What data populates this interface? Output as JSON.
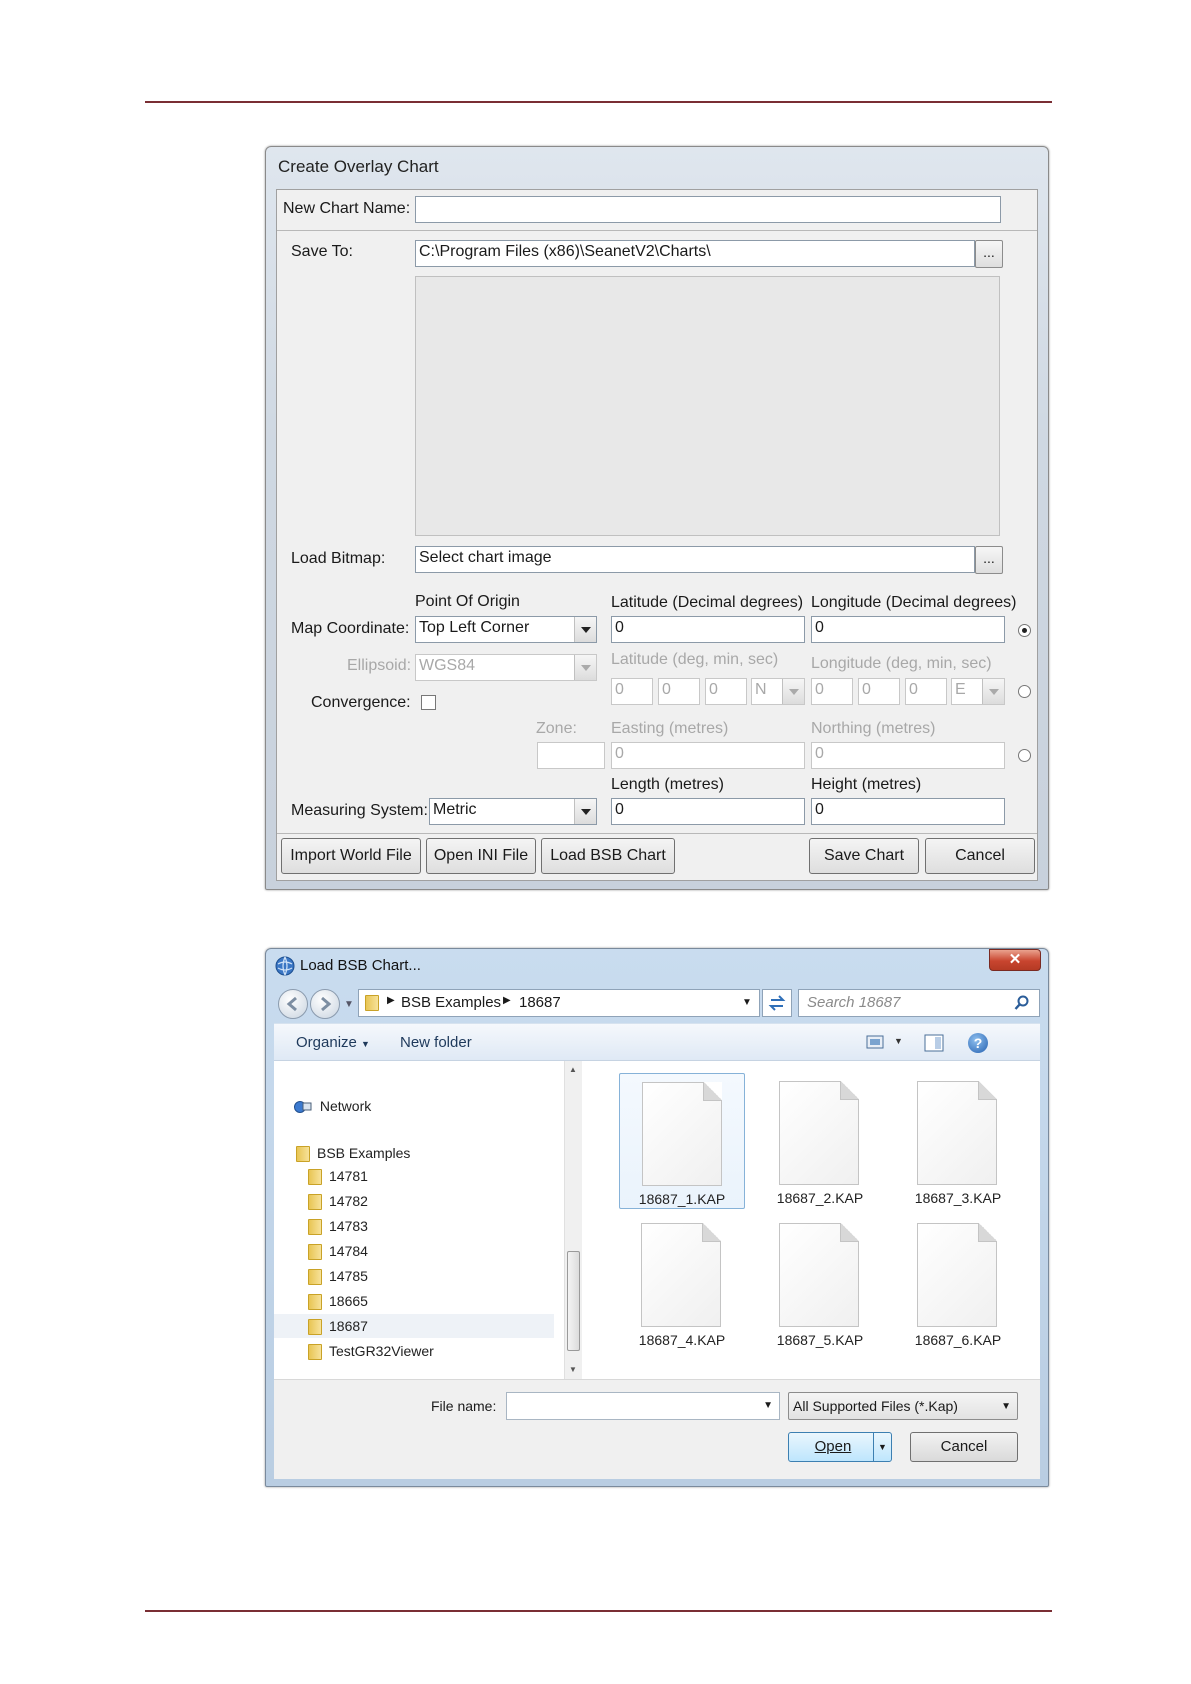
{
  "create_dialog": {
    "title": "Create Overlay Chart",
    "new_chart_name_label": "New Chart Name:",
    "new_chart_name_value": "",
    "save_to_label": "Save To:",
    "save_to_value": "C:\\Program Files (x86)\\SeanetV2\\Charts\\",
    "browse_label": "...",
    "load_bitmap_label": "Load Bitmap:",
    "load_bitmap_value": "Select chart image",
    "point_of_origin_label": "Point Of Origin",
    "map_coordinate_label": "Map Coordinate:",
    "map_coordinate_value": "Top Left Corner",
    "lat_decimal_label": "Latitude (Decimal degrees)",
    "lon_decimal_label": "Longitude (Decimal degrees)",
    "lat_decimal_value": "0",
    "lon_decimal_value": "0",
    "ellipsoid_label": "Ellipsoid:",
    "ellipsoid_value": "WGS84",
    "lat_dms_label": "Latitude (deg, min, sec)",
    "lon_dms_label": "Longitude (deg, min, sec)",
    "lat_dms": [
      "0",
      "0",
      "0"
    ],
    "lat_hemi": "N",
    "lon_dms": [
      "0",
      "0",
      "0"
    ],
    "lon_hemi": "E",
    "convergence_label": "Convergence:",
    "zone_label": "Zone:",
    "zone_value": "",
    "easting_label": "Easting (metres)",
    "northing_label": "Northing (metres)",
    "easting_value": "0",
    "northing_value": "0",
    "length_label": "Length (metres)",
    "height_label": "Height (metres)",
    "length_value": "0",
    "height_value": "0",
    "measuring_system_label": "Measuring System:",
    "measuring_system_value": "Metric",
    "buttons": {
      "import_world_file": "Import World File",
      "open_ini_file": "Open INI File",
      "load_bsb_chart": "Load BSB Chart",
      "save_chart": "Save Chart",
      "cancel": "Cancel"
    },
    "selected_coordinate_mode": "decimal"
  },
  "load_dialog": {
    "title": "Load BSB Chart...",
    "close_glyph": "✕",
    "breadcrumb": [
      "BSB Examples",
      "18687"
    ],
    "search_placeholder": "Search 18687",
    "organize_label": "Organize",
    "new_folder_label": "New folder",
    "tree": {
      "network": "Network",
      "root": "BSB Examples",
      "folders": [
        "14781",
        "14782",
        "14783",
        "14784",
        "14785",
        "18665",
        "18687",
        "TestGR32Viewer"
      ],
      "selected": "18687"
    },
    "files": [
      "18687_1.KAP",
      "18687_2.KAP",
      "18687_3.KAP",
      "18687_4.KAP",
      "18687_5.KAP",
      "18687_6.KAP"
    ],
    "selected_file": "18687_1.KAP",
    "file_name_label": "File name:",
    "file_name_value": "",
    "filter_value": "All Supported Files (*.Kap)",
    "open_label": "Open",
    "cancel_label": "Cancel",
    "help_glyph": "?"
  }
}
